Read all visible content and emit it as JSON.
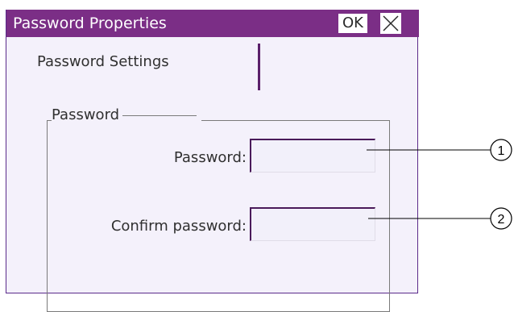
{
  "window": {
    "title": "Password Properties",
    "ok_label": "OK"
  },
  "tabs": [
    {
      "label": "Password Settings"
    }
  ],
  "group": {
    "title": "Password"
  },
  "fields": [
    {
      "label": "Password:",
      "value": ""
    },
    {
      "label": "Confirm password:",
      "value": ""
    }
  ],
  "callouts": [
    "1",
    "2"
  ],
  "colors": {
    "titlebar": "#7b2e86",
    "window_bg": "#f4f1fb",
    "accent_border": "#5a2a8a"
  },
  "icons": {
    "close": "close-icon"
  }
}
